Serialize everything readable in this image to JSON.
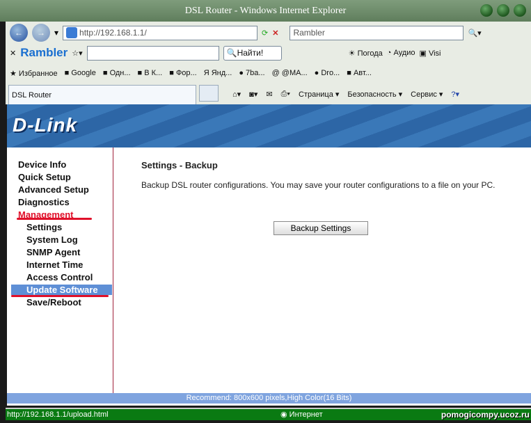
{
  "window": {
    "title": "DSL Router - Windows Internet Explorer"
  },
  "address": {
    "url": "http://192.168.1.1/",
    "search_placeholder": "Rambler"
  },
  "rambler_toolbar": {
    "brand": "Rambler",
    "search_value": "",
    "find_button": "Найти!",
    "items": [
      "Погода",
      "Аудио",
      "Visi"
    ]
  },
  "favorites": {
    "label": "Избранное",
    "items": [
      "Google",
      "Одн...",
      "В К...",
      "Фор...",
      "Янд...",
      "7ba...",
      "@MA...",
      "Dro...",
      "Авт..."
    ]
  },
  "tab": {
    "title": "DSL Router"
  },
  "command_bar": {
    "page": "Страница",
    "safety": "Безопасность",
    "tools": "Сервис"
  },
  "page": {
    "logo": "D-Link",
    "menu": [
      {
        "label": "Device Info",
        "level": "top"
      },
      {
        "label": "Quick Setup",
        "level": "top"
      },
      {
        "label": "Advanced Setup",
        "level": "top"
      },
      {
        "label": "Diagnostics",
        "level": "top"
      },
      {
        "label": "Management",
        "level": "top"
      },
      {
        "label": "Settings",
        "level": "sub"
      },
      {
        "label": "System Log",
        "level": "sub"
      },
      {
        "label": "SNMP Agent",
        "level": "sub"
      },
      {
        "label": "Internet Time",
        "level": "sub"
      },
      {
        "label": "Access Control",
        "level": "sub"
      },
      {
        "label": "Update Software",
        "level": "sub",
        "highlighted": true
      },
      {
        "label": "Save/Reboot",
        "level": "sub"
      }
    ],
    "heading": "Settings - Backup",
    "description": "Backup DSL router configurations. You may save your router configurations to a file on your PC.",
    "backup_button": "Backup Settings",
    "footer": "Recommend: 800x600 pixels,High Color(16 Bits)"
  },
  "status": {
    "url": "http://192.168.1.1/upload.html",
    "zone": "Интернет",
    "watermark": "pomogicompy.ucoz.ru"
  },
  "colors": {
    "banner": "#3a78b8",
    "highlight": "#5e8fd6",
    "underline": "#e0102a",
    "status": "#0a7a12"
  }
}
